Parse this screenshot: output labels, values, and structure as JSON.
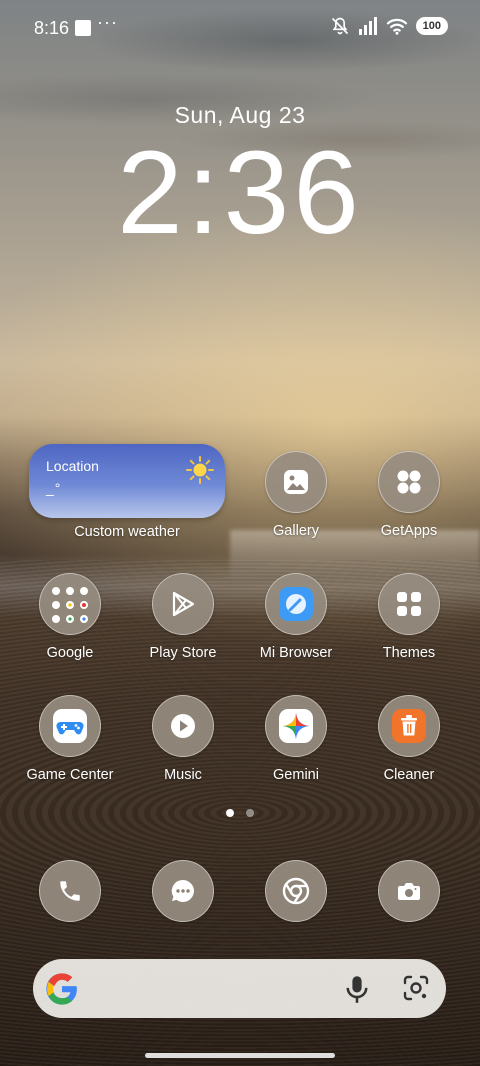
{
  "status_bar": {
    "time": "8:16",
    "overflow": "···",
    "battery": "100"
  },
  "lockclock": {
    "date": "Sun, Aug 23",
    "time": "2:36"
  },
  "weather_widget": {
    "location": "Location",
    "temperature": "_°",
    "label": "Custom weather"
  },
  "apps_row1": [
    {
      "label": "Gallery",
      "icon": "gallery-icon"
    },
    {
      "label": "GetApps",
      "icon": "getapps-icon"
    }
  ],
  "apps_row2": [
    {
      "label": "Google",
      "icon": "google-folder-icon"
    },
    {
      "label": "Play Store",
      "icon": "play-store-icon"
    },
    {
      "label": "Mi Browser",
      "icon": "mi-browser-icon"
    },
    {
      "label": "Themes",
      "icon": "themes-icon"
    }
  ],
  "apps_row3": [
    {
      "label": "Game Center",
      "icon": "game-center-icon"
    },
    {
      "label": "Music",
      "icon": "music-icon"
    },
    {
      "label": "Gemini",
      "icon": "gemini-icon"
    },
    {
      "label": "Cleaner",
      "icon": "cleaner-icon"
    }
  ],
  "dock": [
    {
      "icon": "phone-icon"
    },
    {
      "icon": "messages-icon"
    },
    {
      "icon": "chrome-icon"
    },
    {
      "icon": "camera-icon"
    }
  ],
  "page_indicator": {
    "pages": 2,
    "active": 1
  },
  "search_bar": {
    "icons": [
      "google-g-icon",
      "microphone-icon",
      "google-lens-icon"
    ]
  },
  "colors": {
    "icon_circle": "#968c80",
    "widget_top": "#4e66c2",
    "search_bg": "#ebe9e5"
  }
}
